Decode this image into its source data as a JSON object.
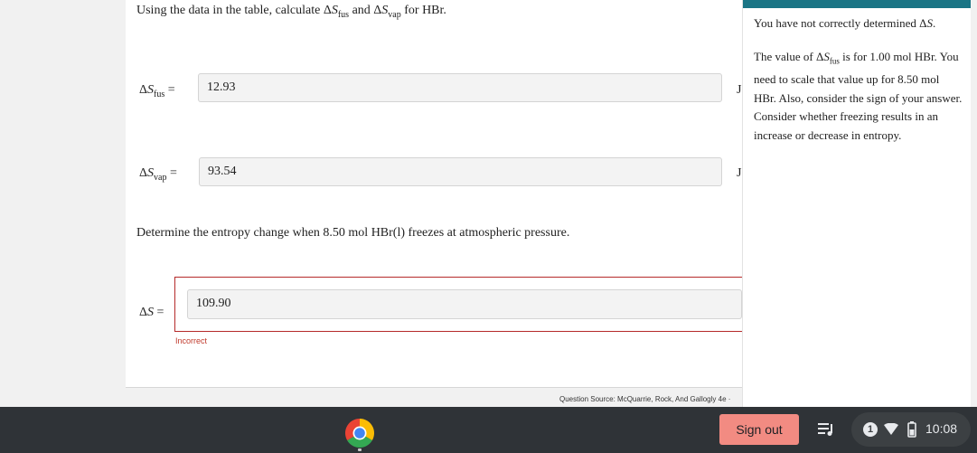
{
  "question": {
    "instruction_prefix": "Using the data in the table, calculate ",
    "instruction_and": " and ",
    "instruction_suffix": " for HBr.",
    "delta_symbol": "Δ",
    "s_symbol": "S",
    "fus_sub": "fus",
    "vap_sub": "vap",
    "equals": "=",
    "fus_value": "12.93",
    "vap_value": "93.54",
    "unit_fus": "J",
    "unit_vap": "J",
    "part2_text": "Determine the entropy change when 8.50 mol HBr(l) freezes at atmospheric pressure.",
    "answer_value": "109.90",
    "feedback": "Incorrect",
    "source": "Question Source: McQuarrie, Rock, And Gallogly 4e ·"
  },
  "hint": {
    "line1_prefix": "You have not correctly determined ",
    "line1_suffix": ".",
    "line2_prefix": "The value of ",
    "line2_suffix": " is for 1.00 mol HBr. You need to scale that value up for 8.50 mol HBr. Also, consider the sign of your answer. Consider whether freezing results in an increase or decrease in entropy."
  },
  "taskbar": {
    "sign_out_label": "Sign out",
    "notification_count": "1",
    "time": "10:08",
    "icons": [
      "chrome-icon",
      "media-queue-icon",
      "wifi-icon",
      "battery-icon"
    ]
  },
  "colors": {
    "hint_accent": "#1a7585",
    "error": "#b52a2a",
    "sign_out": "#f28b82"
  }
}
